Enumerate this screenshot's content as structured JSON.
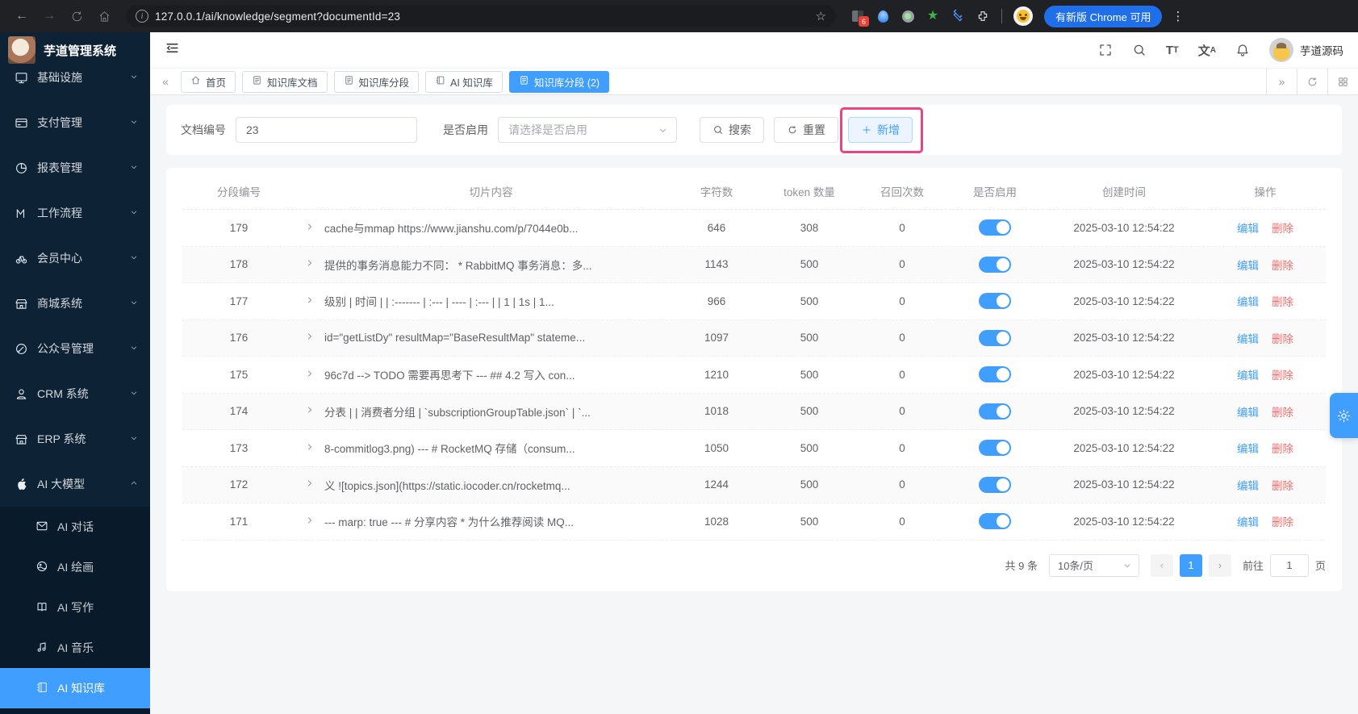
{
  "browser": {
    "url": "127.0.0.1/ai/knowledge/segment?documentId=23",
    "extension_badge": "6",
    "update_pill": "有新版 Chrome 可用"
  },
  "sidebar": {
    "logo_title": "芋道管理系统",
    "items": [
      {
        "label": "基础设施",
        "icon": "infra-icon",
        "caret": "down",
        "partial": true
      },
      {
        "label": "支付管理",
        "icon": "payment-icon",
        "caret": "down"
      },
      {
        "label": "报表管理",
        "icon": "report-icon",
        "caret": "down"
      },
      {
        "label": "工作流程",
        "icon": "workflow-icon",
        "caret": "down"
      },
      {
        "label": "会员中心",
        "icon": "member-icon",
        "caret": "down"
      },
      {
        "label": "商城系统",
        "icon": "mall-icon",
        "caret": "down"
      },
      {
        "label": "公众号管理",
        "icon": "official-account-icon",
        "caret": "down"
      },
      {
        "label": "CRM 系统",
        "icon": "crm-icon",
        "caret": "down"
      },
      {
        "label": "ERP 系统",
        "icon": "erp-icon",
        "caret": "down"
      },
      {
        "label": "AI 大模型",
        "icon": "apple-ai-icon",
        "caret": "up"
      }
    ],
    "submenu": [
      {
        "label": "AI 对话",
        "icon": "chat-icon"
      },
      {
        "label": "AI 绘画",
        "icon": "paint-icon"
      },
      {
        "label": "AI 写作",
        "icon": "write-icon"
      },
      {
        "label": "AI 音乐",
        "icon": "music-icon"
      },
      {
        "label": "AI 知识库",
        "icon": "knowledge-icon",
        "active": true
      }
    ]
  },
  "header": {
    "user_name": "芋道源码"
  },
  "tabs": [
    {
      "label": "首页",
      "icon": "home-icon"
    },
    {
      "label": "知识库文档",
      "icon": "doc-icon"
    },
    {
      "label": "知识库分段",
      "icon": "doc-icon"
    },
    {
      "label": "AI 知识库",
      "icon": "book-icon"
    },
    {
      "label": "知识库分段 (2)",
      "icon": "doc-icon",
      "active": true
    }
  ],
  "filter": {
    "doc_label": "文档编号",
    "doc_value": "23",
    "enable_label": "是否启用",
    "enable_placeholder": "请选择是否启用",
    "search_label": "搜索",
    "reset_label": "重置",
    "add_label": "新增"
  },
  "table": {
    "headers": [
      "分段编号",
      "切片内容",
      "字符数",
      "token 数量",
      "召回次数",
      "是否启用",
      "创建时间",
      "操作"
    ],
    "edit_label": "编辑",
    "delete_label": "删除",
    "rows": [
      {
        "id": "179",
        "content": "cache与mmap https://www.jianshu.com/p/7044e0b...",
        "chars": "646",
        "tokens": "308",
        "recalls": "0",
        "enabled": true,
        "time": "2025-03-10 12:54:22"
      },
      {
        "id": "178",
        "content": "提供的事务消息能力不同： * RabbitMQ 事务消息：多...",
        "chars": "1143",
        "tokens": "500",
        "recalls": "0",
        "enabled": true,
        "time": "2025-03-10 12:54:22"
      },
      {
        "id": "177",
        "content": "级别 | 时间 | | :------- | :--- | ---- | :--- | | 1 | 1s | 1...",
        "chars": "966",
        "tokens": "500",
        "recalls": "0",
        "enabled": true,
        "time": "2025-03-10 12:54:22"
      },
      {
        "id": "176",
        "content": "id=\"getListDy\" resultMap=\"BaseResultMap\" stateme...",
        "chars": "1097",
        "tokens": "500",
        "recalls": "0",
        "enabled": true,
        "time": "2025-03-10 12:54:22"
      },
      {
        "id": "175",
        "content": "96c7d --> TODO 需要再思考下 --- ## 4.2 写入 con...",
        "chars": "1210",
        "tokens": "500",
        "recalls": "0",
        "enabled": true,
        "time": "2025-03-10 12:54:22"
      },
      {
        "id": "174",
        "content": "分表 | | 消费者分组 | `subscriptionGroupTable.json` | `...",
        "chars": "1018",
        "tokens": "500",
        "recalls": "0",
        "enabled": true,
        "time": "2025-03-10 12:54:22"
      },
      {
        "id": "173",
        "content": "8-commitlog3.png) --- # RocketMQ 存储（consum...",
        "chars": "1050",
        "tokens": "500",
        "recalls": "0",
        "enabled": true,
        "time": "2025-03-10 12:54:22"
      },
      {
        "id": "172",
        "content": "义 ![topics.json](https://static.iocoder.cn/rocketmq...",
        "chars": "1244",
        "tokens": "500",
        "recalls": "0",
        "enabled": true,
        "time": "2025-03-10 12:54:22"
      },
      {
        "id": "171",
        "content": "--- marp: true --- # 分享内容 * 为什么推荐阅读 MQ...",
        "chars": "1028",
        "tokens": "500",
        "recalls": "0",
        "enabled": true,
        "time": "2025-03-10 12:54:22"
      }
    ]
  },
  "pagination": {
    "total": "共 9 条",
    "page_size": "10条/页",
    "current_page": "1",
    "goto_prefix": "前往",
    "goto_value": "1",
    "goto_suffix": "页"
  },
  "colors": {
    "primary": "#409eff",
    "danger": "#f56c6c",
    "annotation": "#f1427e",
    "sidebar_bg": "#0e2236"
  }
}
